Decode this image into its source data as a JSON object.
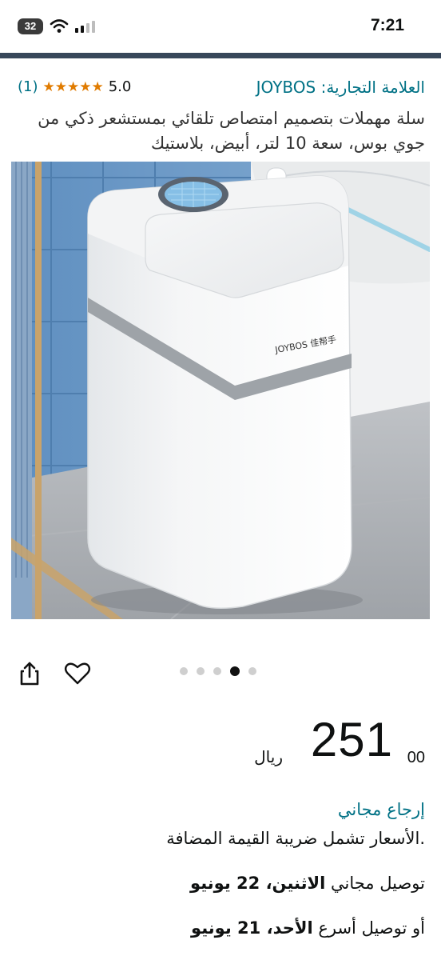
{
  "status_bar": {
    "battery": "32",
    "time": "7:21"
  },
  "product": {
    "brand_label": "العلامة التجارية: JOYBOS",
    "rating": "5.0",
    "rating_count": "(1)",
    "stars": "★★★★★",
    "title": "سلة مهملات بتصميم امتصاص تلقائي بمستشعر ذكي من جوي بوس، سعة 10 لتر، أبيض، بلاستيك",
    "image_brand_print": "JOYBOS 佳帮手",
    "carousel": {
      "count": 5,
      "active_index": 3
    }
  },
  "icons": {
    "share": "share-icon",
    "wishlist": "heart-icon"
  },
  "price": {
    "whole": "251",
    "fraction": "00",
    "currency": "ريال"
  },
  "returns_text": "إرجاع مجاني",
  "vat_text": ".الأسعار تشمل ضريبة القيمة المضافة",
  "delivery": {
    "prefix": "توصيل مجاني ",
    "date": "الاثنين، 22 يونيو"
  },
  "fast_delivery": {
    "prefix": "أو توصيل أسرع ",
    "date": "الأحد، 21 يونيو"
  },
  "colors": {
    "link": "#007185",
    "star": "#e07b00",
    "header_bar": "#37475a"
  }
}
